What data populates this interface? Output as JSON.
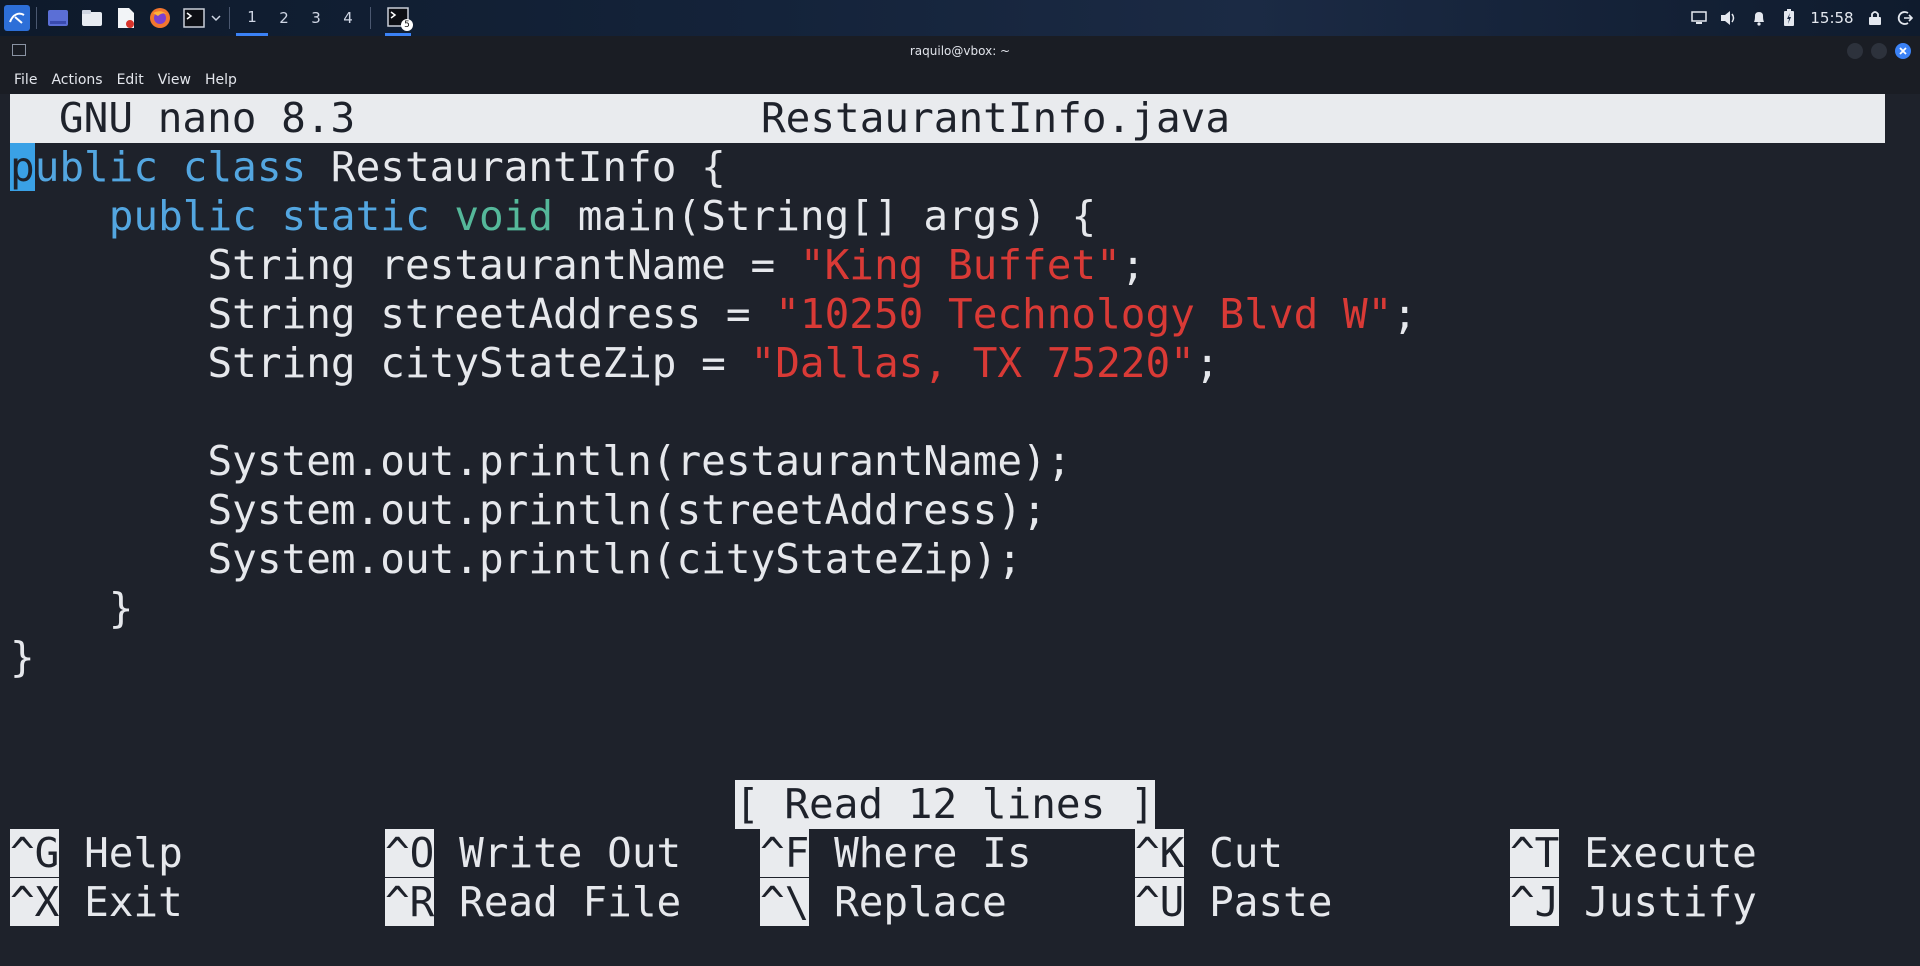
{
  "taskbar": {
    "workspaces": [
      "1",
      "2",
      "3",
      "4"
    ],
    "terminal_badge": "5",
    "clock": "15:58"
  },
  "window": {
    "title": "raquilo@vbox: ~",
    "menu": [
      "File",
      "Actions",
      "Edit",
      "View",
      "Help"
    ]
  },
  "nano": {
    "version": "GNU nano 8.3",
    "filename": "RestaurantInfo.java",
    "status": "[ Read 12 lines ]",
    "code": {
      "l1_cursor": "p",
      "l1_kw": "ublic class",
      "l1_rest": " RestaurantInfo {",
      "l2_indent": "    ",
      "l2_kw": "public static",
      "l2_sp": " ",
      "l2_type": "void",
      "l2_rest": " main(String[] args) {",
      "l3_pre": "        String restaurantName = ",
      "l3_str": "\"King Buffet\"",
      "l3_end": ";",
      "l4_pre": "        String streetAddress = ",
      "l4_str": "\"10250 Technology Blvd W\"",
      "l4_end": ";",
      "l5_pre": "        String cityStateZip = ",
      "l5_str": "\"Dallas, TX 75220\"",
      "l5_end": ";",
      "l7": "        System.out.println(restaurantName);",
      "l8": "        System.out.println(streetAddress);",
      "l9": "        System.out.println(cityStateZip);",
      "l10": "    }",
      "l11": "}"
    },
    "shortcuts": [
      {
        "key": "^G",
        "label": "Help"
      },
      {
        "key": "^O",
        "label": "Write Out"
      },
      {
        "key": "^F",
        "label": "Where Is"
      },
      {
        "key": "^K",
        "label": "Cut"
      },
      {
        "key": "^T",
        "label": "Execute"
      },
      {
        "key": "^X",
        "label": "Exit"
      },
      {
        "key": "^R",
        "label": "Read File"
      },
      {
        "key": "^\\",
        "label": "Replace"
      },
      {
        "key": "^U",
        "label": "Paste"
      },
      {
        "key": "^J",
        "label": "Justify"
      }
    ]
  },
  "colors": {
    "keyword": "#53a6e0",
    "type": "#55b89a",
    "string": "#d93a36",
    "background": "#1e222b",
    "bar": "#e9ebee"
  }
}
